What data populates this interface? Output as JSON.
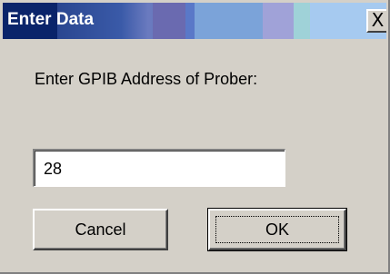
{
  "window": {
    "title": "Enter Data",
    "close_symbol": "X"
  },
  "dialog": {
    "prompt": "Enter GPIB Address of Prober:",
    "input_value": "28"
  },
  "buttons": {
    "cancel_label": "Cancel",
    "ok_label": "OK"
  },
  "colors": {
    "titlebar_start": "#0a246a",
    "dialog_background": "#d4d0c8"
  },
  "icons": {
    "close": "close-icon"
  }
}
